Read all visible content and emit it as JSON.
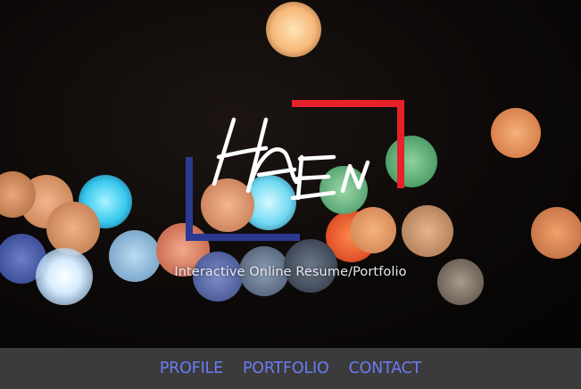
{
  "hero": {
    "tagline": "Interactive Online Resume/Portfolio",
    "logo_alt": "HAEN handwritten logo",
    "frame_colors": {
      "top_right": "#e8202a",
      "bottom_left": "#2b3990"
    }
  },
  "nav": {
    "items": [
      {
        "label": "PROFILE"
      },
      {
        "label": "PORTFOLIO"
      },
      {
        "label": "CONTACT"
      }
    ],
    "link_color": "#6b7cf2",
    "background": "#3b3b3b"
  }
}
